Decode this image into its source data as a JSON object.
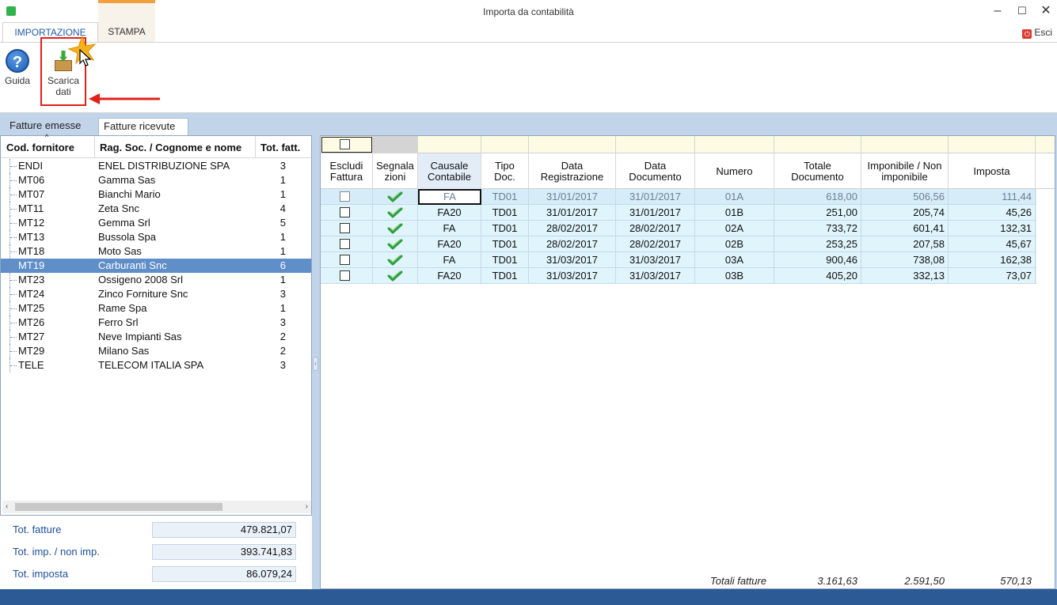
{
  "window": {
    "title": "Importa da contabilità"
  },
  "ribbon": {
    "tabs": [
      "IMPORTAZIONE",
      "STAMPA"
    ],
    "exit_label": "Esci",
    "help_label": "Guida",
    "download_label_1": "Scarica",
    "download_label_2": "dati"
  },
  "section_tabs": [
    "Fatture emesse",
    "Fatture ricevute"
  ],
  "suppliers": {
    "columns": [
      "Cod. fornitore",
      "Rag. Soc. / Cognome e nome",
      "Tot. fatt."
    ],
    "rows": [
      {
        "code": "ENDI",
        "name": "ENEL DISTRIBUZIONE SPA",
        "count": "3"
      },
      {
        "code": "MT06",
        "name": "Gamma Sas",
        "count": "1"
      },
      {
        "code": "MT07",
        "name": "Bianchi Mario",
        "count": "1"
      },
      {
        "code": "MT11",
        "name": "Zeta Snc",
        "count": "4"
      },
      {
        "code": "MT12",
        "name": "Gemma Srl",
        "count": "5"
      },
      {
        "code": "MT13",
        "name": "Bussola Spa",
        "count": "1"
      },
      {
        "code": "MT18",
        "name": "Moto Sas",
        "count": "1"
      },
      {
        "code": "MT19",
        "name": "Carburanti Snc",
        "count": "6"
      },
      {
        "code": "MT23",
        "name": "Ossigeno 2008 Srl",
        "count": "1"
      },
      {
        "code": "MT24",
        "name": "Zinco Forniture Snc",
        "count": "3"
      },
      {
        "code": "MT25",
        "name": "Rame Spa",
        "count": "1"
      },
      {
        "code": "MT26",
        "name": "Ferro Srl",
        "count": "3"
      },
      {
        "code": "MT27",
        "name": "Neve Impianti Sas",
        "count": "2"
      },
      {
        "code": "MT29",
        "name": "Milano Sas",
        "count": "2"
      },
      {
        "code": "TELE",
        "name": "TELECOM ITALIA SPA",
        "count": "3"
      }
    ],
    "selected_code": "MT19"
  },
  "totals": {
    "fatture_label": "Tot. fatture",
    "fatture_value": "479.821,07",
    "imp_label": "Tot. imp. / non imp.",
    "imp_value": "393.741,83",
    "imposta_label": "Tot. imposta",
    "imposta_value": "86.079,24"
  },
  "invoices": {
    "columns": [
      "Escludi\nFattura",
      "Segnala\nzioni",
      "Causale\nContabile",
      "Tipo\nDoc.",
      "Data\nRegistrazione",
      "Data\nDocumento",
      "Numero",
      "Totale\nDocumento",
      "Imponibile / Non\nimponibile",
      "Imposta"
    ],
    "rows": [
      {
        "causale": "FA",
        "tipo": "TD01",
        "data_reg": "31/01/2017",
        "data_doc": "31/01/2017",
        "numero": "01A",
        "totale": "618,00",
        "imponibile": "506,56",
        "imposta": "111,44"
      },
      {
        "causale": "FA20",
        "tipo": "TD01",
        "data_reg": "31/01/2017",
        "data_doc": "31/01/2017",
        "numero": "01B",
        "totale": "251,00",
        "imponibile": "205,74",
        "imposta": "45,26"
      },
      {
        "causale": "FA",
        "tipo": "TD01",
        "data_reg": "28/02/2017",
        "data_doc": "28/02/2017",
        "numero": "02A",
        "totale": "733,72",
        "imponibile": "601,41",
        "imposta": "132,31"
      },
      {
        "causale": "FA20",
        "tipo": "TD01",
        "data_reg": "28/02/2017",
        "data_doc": "28/02/2017",
        "numero": "02B",
        "totale": "253,25",
        "imponibile": "207,58",
        "imposta": "45,67"
      },
      {
        "causale": "FA",
        "tipo": "TD01",
        "data_reg": "31/03/2017",
        "data_doc": "31/03/2017",
        "numero": "03A",
        "totale": "900,46",
        "imponibile": "738,08",
        "imposta": "162,38"
      },
      {
        "causale": "FA20",
        "tipo": "TD01",
        "data_reg": "31/03/2017",
        "data_doc": "31/03/2017",
        "numero": "03B",
        "totale": "405,20",
        "imponibile": "332,13",
        "imposta": "73,07"
      }
    ],
    "footer_label": "Totali fatture",
    "footer_totale": "3.161,63",
    "footer_imponibile": "2.591,50",
    "footer_imposta": "570,13"
  },
  "colors": {
    "accent": "#1e5aa8",
    "selection": "#5f8ec9",
    "highlight": "#e0201b",
    "band": "#c1d4ea"
  }
}
